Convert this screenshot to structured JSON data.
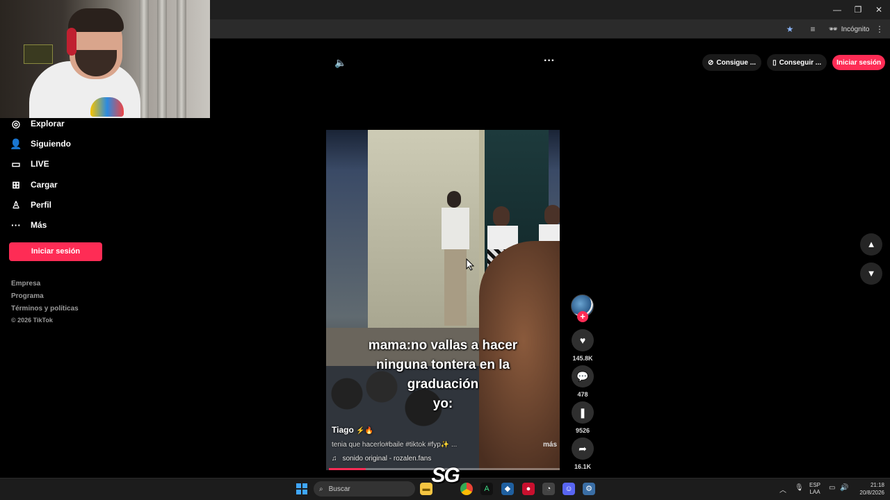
{
  "browser": {
    "incognito_label": "Incógnito",
    "window_controls": [
      "minimize-icon",
      "restore-icon",
      "close-icon"
    ]
  },
  "sidebar": {
    "items": [
      {
        "label": "Explorar",
        "icon": "compass-icon"
      },
      {
        "label": "Siguiendo",
        "icon": "user-follow-icon"
      },
      {
        "label": "LIVE",
        "icon": "live-tv-icon"
      },
      {
        "label": "Cargar",
        "icon": "upload-plus-icon"
      },
      {
        "label": "Perfil",
        "icon": "profile-icon"
      },
      {
        "label": "Más",
        "icon": "more-dots-icon"
      }
    ],
    "login_button": "Iniciar sesión",
    "footer_links": [
      "Empresa",
      "Programa",
      "Términos y políticas"
    ],
    "copyright": "© 2026 TikTok"
  },
  "header": {
    "get_coins": "Consigue ...",
    "get_app": "Conseguir ...",
    "login_button": "Iniciar sesión"
  },
  "video": {
    "caption_lines": [
      "mama:no vallas a hacer",
      "ninguna tontera en la",
      "graduación",
      "yo:"
    ],
    "author": "Tiago",
    "description": "tenia que hacerlo#baile #tiktok #fyp✨ ...",
    "more_link": "más",
    "music": "sonido original - rozalen.fans",
    "progress": 0.16
  },
  "actions": {
    "likes": "145.8K",
    "comments": "478",
    "saves": "9526",
    "shares": "16.1K"
  },
  "taskbar": {
    "search_placeholder": "Buscar",
    "lang_line1": "ESP",
    "lang_line2": "LAA",
    "time": "21:18",
    "date": "20/8/2026",
    "overlay_logo": "SG"
  },
  "colors": {
    "accent": "#fe2c55",
    "background": "#000000"
  }
}
